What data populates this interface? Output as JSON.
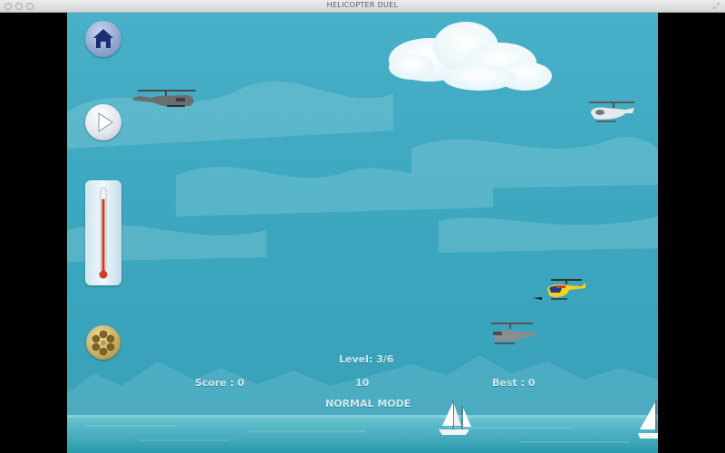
{
  "window": {
    "title": "HELICOPTER DUEL"
  },
  "hud": {
    "level": "Level: 3/6",
    "score": "Score : 0",
    "center_value": "10",
    "best": "Best : 0",
    "mode": "NORMAL MODE"
  },
  "controls": {
    "home_icon": "home-icon",
    "play_icon": "play-icon",
    "thermometer_level": 0.9,
    "revolver_icon": "revolver-cylinder-icon"
  },
  "colors": {
    "sky": "#3ca7bf",
    "sea": "#3fb5c4",
    "hud_text": "#cfe7ee",
    "player_helicopter": "#f2d21a",
    "thermometer_fill": "#d23b2a"
  }
}
